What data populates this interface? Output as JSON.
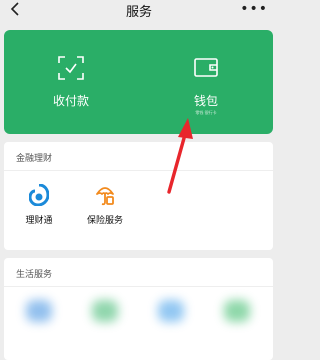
{
  "header": {
    "title": "服务",
    "more_glyph": "•••"
  },
  "wallet_card": {
    "left": {
      "label": "收付款",
      "icon": "scan-qr-icon"
    },
    "right": {
      "label": "钱包",
      "sublabel": "零钱 银行卡",
      "icon": "wallet-icon"
    },
    "color": "#2aae67"
  },
  "finance_section": {
    "title": "金融理财",
    "items": [
      {
        "label": "理财通",
        "icon": "wealth-icon",
        "color": "#1b8ad9"
      },
      {
        "label": "保险服务",
        "icon": "insurance-umbrella-icon",
        "color": "#f28a1d"
      }
    ]
  },
  "life_section": {
    "title": "生活服务"
  },
  "annotation": {
    "arrow_color": "#e8262c"
  }
}
